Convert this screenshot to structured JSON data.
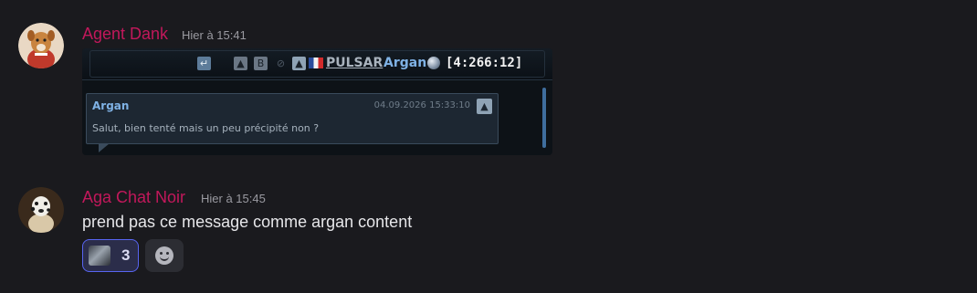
{
  "messages": [
    {
      "username": "Agent Dank",
      "timestamp": "Hier à 15:41",
      "attachment": {
        "player_tag": "PULSAR",
        "player_name": "Argan",
        "coordinates": "[4:266:12]",
        "message": {
          "author": "Argan",
          "date": "04.09.2026 15:33:10",
          "body": "Salut, bien tenté mais un peu précipité non ?"
        }
      }
    },
    {
      "username": "Aga Chat Noir",
      "timestamp": "Hier à 15:45",
      "text": "prend pas ce message comme argan content",
      "reactions": [
        {
          "emoji": "custom-emoji",
          "count": "3",
          "active": true
        }
      ]
    }
  ],
  "colors": {
    "username": "#c2185b",
    "background": "#1a1a1e",
    "reaction_accent": "#5865f2"
  },
  "icons": {
    "reply": "reply-icon",
    "user": "user-icon",
    "buddy": "buddy-icon",
    "block": "block-icon",
    "flag": "france-flag-icon",
    "planet": "planet-icon",
    "alert": "alert-icon",
    "add_reaction": "add-reaction-icon"
  }
}
